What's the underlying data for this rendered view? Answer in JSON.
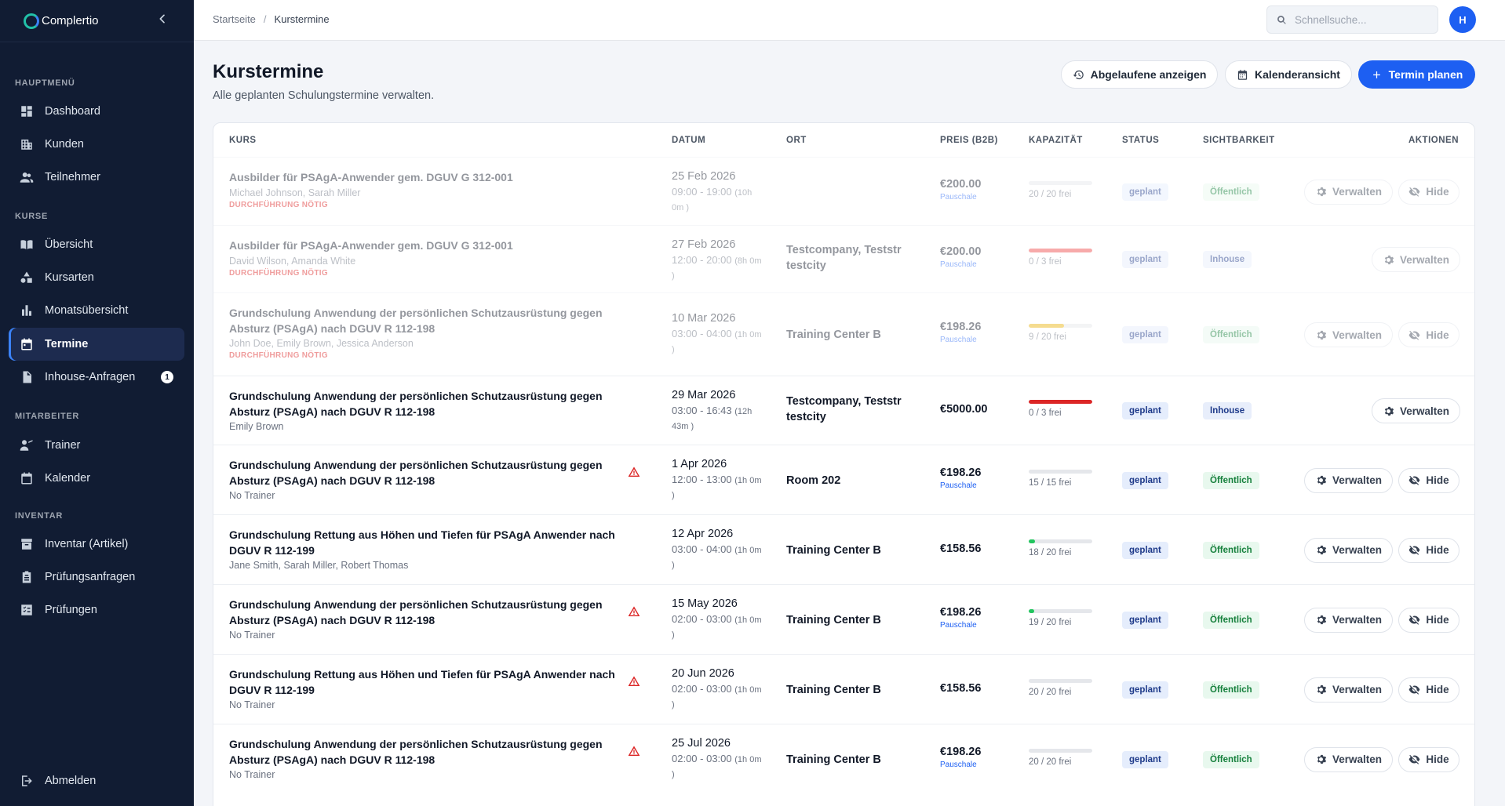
{
  "app": {
    "name": "Complertio"
  },
  "sidebar": {
    "sections": [
      {
        "title": "HAUPTMENÜ"
      },
      {
        "title": "KURSE"
      },
      {
        "title": "MITARBEITER"
      },
      {
        "title": "INVENTAR"
      }
    ],
    "items": [
      {
        "label": "Dashboard",
        "icon": "dashboard-icon"
      },
      {
        "label": "Kunden",
        "icon": "building-icon"
      },
      {
        "label": "Teilnehmer",
        "icon": "people-icon"
      },
      {
        "label": "Übersicht",
        "icon": "book-icon"
      },
      {
        "label": "Kursarten",
        "icon": "shapes-icon"
      },
      {
        "label": "Monatsübersicht",
        "icon": "bar-chart-icon"
      },
      {
        "label": "Termine",
        "icon": "calendar-icon",
        "active": true
      },
      {
        "label": "Inhouse-Anfragen",
        "icon": "document-icon",
        "badge": "1"
      },
      {
        "label": "Trainer",
        "icon": "trainer-icon"
      },
      {
        "label": "Kalender",
        "icon": "calendar-outline-icon"
      },
      {
        "label": "Inventar (Artikel)",
        "icon": "inventory-icon"
      },
      {
        "label": "Prüfungsanfragen",
        "icon": "clipboard-icon"
      },
      {
        "label": "Prüfungen",
        "icon": "checklist-icon"
      }
    ],
    "logout": "Abmelden"
  },
  "topbar": {
    "breadcrumb": [
      "Startseite",
      "Kurstermine"
    ],
    "search_placeholder": "Schnellsuche...",
    "avatar_initial": "H"
  },
  "page": {
    "title": "Kurstermine",
    "subtitle": "Alle geplanten Schulungstermine verwalten.",
    "btn_expired": "Abgelaufene anzeigen",
    "btn_calendar": "Kalenderansicht",
    "btn_plan": "Termin planen"
  },
  "table": {
    "headers": [
      "KURS",
      "DATUM",
      "ORT",
      "PREIS (B2B)",
      "KAPAZITÄT",
      "STATUS",
      "SICHTBARKEIT",
      "AKTIONEN"
    ],
    "action_manage": "Verwalten",
    "action_hide": "Hide",
    "rows": [
      {
        "title": "Ausbilder für PSAgA-Anwender gem. DGUV G 312-001",
        "people": "Michael Johnson, Sarah Miller",
        "flag": "DURCHFÜHRUNG NÖTIG",
        "warn": false,
        "date": "25 Feb 2026",
        "time": "09:00 - 19:00",
        "duration": "(10h 0m )",
        "place": "",
        "price": "€200.00",
        "price_note": "Pauschale",
        "capacity": "20 / 20 frei",
        "booked_fraction": 0,
        "status": "geplant",
        "visibility": "Öffentlich",
        "hide": true,
        "dim": true
      },
      {
        "title": "Ausbilder für PSAgA-Anwender gem. DGUV G 312-001",
        "people": "David Wilson, Amanda White",
        "flag": "DURCHFÜHRUNG NÖTIG",
        "warn": false,
        "date": "27 Feb 2026",
        "time": "12:00 - 20:00",
        "duration": "(8h 0m )",
        "place": "Testcompany, Teststr testcity",
        "price": "€200.00",
        "price_note": "Pauschale",
        "capacity": "0 / 3 frei",
        "booked_fraction": 1,
        "bar_color": "#ef4444",
        "status": "geplant",
        "visibility": "Inhouse",
        "hide": false,
        "dim": true
      },
      {
        "title": "Grundschulung Anwendung der persönlichen Schutzausrüstung gegen Absturz (PSAgA) nach DGUV R 112-198",
        "people": "John Doe, Emily Brown, Jessica Anderson",
        "flag": "DURCHFÜHRUNG NÖTIG",
        "warn": false,
        "date": "10 Mar 2026",
        "time": "03:00 - 04:00",
        "duration": "(1h 0m )",
        "place": "Training Center B",
        "price": "€198.26",
        "price_note": "Pauschale",
        "capacity": "9 / 20 frei",
        "booked_fraction": 0.55,
        "bar_color": "#eab308",
        "status": "geplant",
        "visibility": "Öffentlich",
        "hide": true,
        "dim": true
      },
      {
        "title": "Grundschulung Anwendung der persönlichen Schutzausrüstung gegen Absturz (PSAgA) nach DGUV R 112-198",
        "people": "Emily Brown",
        "flag": "",
        "warn": false,
        "date": "29 Mar 2026",
        "time": "03:00 - 16:43",
        "duration": "(12h 43m )",
        "place": "Testcompany, Teststr testcity",
        "price": "€5000.00",
        "price_note": "",
        "capacity": "0 / 3 frei",
        "booked_fraction": 1,
        "bar_color": "#dc2626",
        "status": "geplant",
        "visibility": "Inhouse",
        "hide": false,
        "dim": false
      },
      {
        "title": "Grundschulung Anwendung der persönlichen Schutzausrüstung gegen Absturz (PSAgA) nach DGUV R 112-198",
        "people": "No Trainer",
        "flag": "",
        "warn": true,
        "date": "1 Apr 2026",
        "time": "12:00 - 13:00",
        "duration": "(1h 0m )",
        "place": "Room 202",
        "price": "€198.26",
        "price_note": "Pauschale",
        "capacity": "15 / 15 frei",
        "booked_fraction": 0,
        "status": "geplant",
        "visibility": "Öffentlich",
        "hide": true,
        "dim": false
      },
      {
        "title": "Grundschulung Rettung aus Höhen und Tiefen für PSAgA Anwender nach DGUV R 112-199",
        "people": "Jane Smith, Sarah Miller, Robert Thomas",
        "flag": "",
        "warn": false,
        "date": "12 Apr 2026",
        "time": "03:00 - 04:00",
        "duration": "(1h 0m )",
        "place": "Training Center B",
        "price": "€158.56",
        "price_note": "",
        "capacity": "18 / 20 frei",
        "booked_fraction": 0.1,
        "bar_color": "#22c55e",
        "status": "geplant",
        "visibility": "Öffentlich",
        "hide": true,
        "dim": false
      },
      {
        "title": "Grundschulung Anwendung der persönlichen Schutzausrüstung gegen Absturz (PSAgA) nach DGUV R 112-198",
        "people": "No Trainer",
        "flag": "",
        "warn": true,
        "date": "15 May 2026",
        "time": "02:00 - 03:00",
        "duration": "(1h 0m )",
        "place": "Training Center B",
        "price": "€198.26",
        "price_note": "Pauschale",
        "capacity": "19 / 20 frei",
        "booked_fraction": 0.05,
        "bar_color": "#22c55e",
        "status": "geplant",
        "visibility": "Öffentlich",
        "hide": true,
        "dim": false
      },
      {
        "title": "Grundschulung Rettung aus Höhen und Tiefen für PSAgA Anwender nach DGUV R 112-199",
        "people": "No Trainer",
        "flag": "",
        "warn": true,
        "date": "20 Jun 2026",
        "time": "02:00 - 03:00",
        "duration": "(1h 0m )",
        "place": "Training Center B",
        "price": "€158.56",
        "price_note": "",
        "capacity": "20 / 20 frei",
        "booked_fraction": 0,
        "status": "geplant",
        "visibility": "Öffentlich",
        "hide": true,
        "dim": false
      },
      {
        "title": "Grundschulung Anwendung der persönlichen Schutzausrüstung gegen Absturz (PSAgA) nach DGUV R 112-198",
        "people": "No Trainer",
        "flag": "",
        "warn": true,
        "date": "25 Jul 2026",
        "time": "02:00 - 03:00",
        "duration": "(1h 0m )",
        "place": "Training Center B",
        "price": "€198.26",
        "price_note": "Pauschale",
        "capacity": "20 / 20 frei",
        "booked_fraction": 0,
        "status": "geplant",
        "visibility": "Öffentlich",
        "hide": true,
        "dim": false
      }
    ]
  }
}
